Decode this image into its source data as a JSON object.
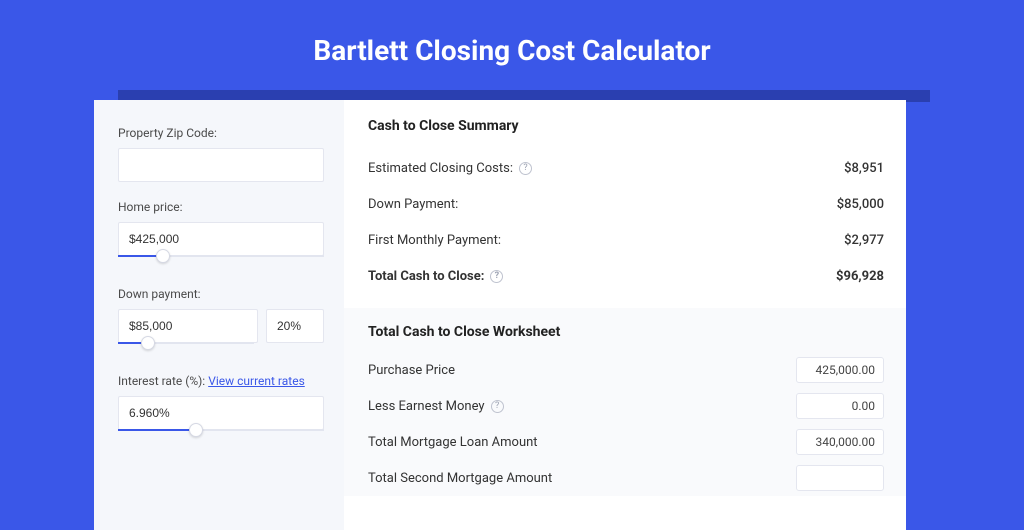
{
  "title": "Bartlett Closing Cost Calculator",
  "sidebar": {
    "zip_label": "Property Zip Code:",
    "zip_value": "",
    "home_price_label": "Home price:",
    "home_price_value": "$425,000",
    "home_price_slider_pct": 22,
    "down_payment_label": "Down payment:",
    "down_payment_value": "$85,000",
    "down_payment_pct": "20%",
    "down_payment_slider_pct": 22,
    "interest_label_prefix": "Interest rate (%): ",
    "interest_link": "View current rates",
    "interest_value": "6.960%",
    "interest_slider_pct": 38
  },
  "summary": {
    "title": "Cash to Close Summary",
    "rows": [
      {
        "label": "Estimated Closing Costs:",
        "help": true,
        "value": "$8,951",
        "bold": false
      },
      {
        "label": "Down Payment:",
        "help": false,
        "value": "$85,000",
        "bold": false
      },
      {
        "label": "First Monthly Payment:",
        "help": false,
        "value": "$2,977",
        "bold": false
      },
      {
        "label": "Total Cash to Close:",
        "help": true,
        "value": "$96,928",
        "bold": true
      }
    ]
  },
  "worksheet": {
    "title": "Total Cash to Close Worksheet",
    "rows": [
      {
        "label": "Purchase Price",
        "help": false,
        "value": "425,000.00"
      },
      {
        "label": "Less Earnest Money",
        "help": true,
        "value": "0.00"
      },
      {
        "label": "Total Mortgage Loan Amount",
        "help": false,
        "value": "340,000.00"
      },
      {
        "label": "Total Second Mortgage Amount",
        "help": false,
        "value": ""
      }
    ]
  }
}
